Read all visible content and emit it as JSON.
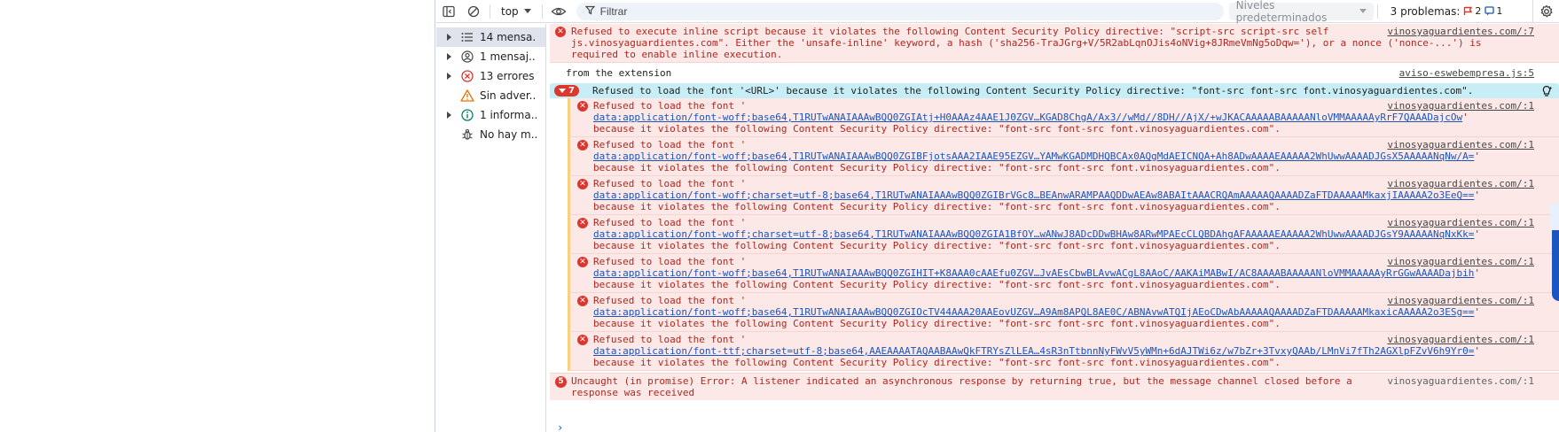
{
  "toolbar": {
    "context_label": "top",
    "filter_placeholder": "Filtrar",
    "levels_label": "Niveles predeterminados",
    "problems_label": "3 problemas:",
    "problems_errors": "2",
    "problems_info": "1"
  },
  "sidebar": {
    "items": [
      {
        "label": "14 mensa...",
        "icon": "list-icon"
      },
      {
        "label": "1 mensaj...",
        "icon": "user-icon"
      },
      {
        "label": "13 errores",
        "icon": "error-icon"
      },
      {
        "label": "Sin adver...",
        "icon": "warning-icon"
      },
      {
        "label": "1 informa...",
        "icon": "info-icon"
      },
      {
        "label": "No hay m...",
        "icon": "bug-icon"
      }
    ]
  },
  "console": {
    "csp_message": {
      "lines": [
        "Refused to execute inline script because it violates the following Content Security Policy directive: \"script-src script-src self",
        "js.vinosyaguardientes.com\". Either the 'unsafe-inline' keyword, a hash ('sha256-TraJGrg+V/5R2abLqnOJis4oNVig+8JRmeVmNg5oDqw='), or a nonce ('nonce-...') is",
        "required to enable inline execution."
      ],
      "source": "vinosyaguardientes.com/:7"
    },
    "extension_message": {
      "text": "from the extension",
      "source": "aviso-eswebempresa.js:5"
    },
    "group": {
      "count": "7",
      "text": "Refused to load the font '<URL>' because it violates the following Content Security Policy directive: \"font-src font-src font.vinosyaguardientes.com\"."
    },
    "font_errors": [
      {
        "prefix": "Refused to load the font '",
        "url": "data:application/font-woff;base64,T1RUTwANAIAAAwBQQ0ZGIAtj+H0AAAz4AAE1J0ZGV…KGAD8ChgA/Ax3//wMd//8DH//AjX/+wJKACAAAAABAAAAANloVMMAAAAAyRrF7QAAADajcOw",
        "suffix": "'",
        "tail": "because it violates the following Content Security Policy directive: \"font-src font-src font.vinosyaguardientes.com\".",
        "source": "vinosyaguardientes.com/:1"
      },
      {
        "prefix": "Refused to load the font '",
        "url": "data:application/font-woff;base64,T1RUTwANAIAAAwBQQ0ZGIBFjotsAAA2IAAE95EZGV…YAMwKGADMDHQBCAx0AQgMdAEICNQA+Ah8ADwAAAAEAAAAA2WhUwwAAAADJGsX5AAAAANqNw/A=",
        "suffix": "'",
        "tail": "because it violates the following Content Security Policy directive: \"font-src font-src font.vinosyaguardientes.com\".",
        "source": "vinosyaguardientes.com/:1"
      },
      {
        "prefix": "Refused to load the font '",
        "url": "data:application/font-woff;charset=utf-8;base64,T1RUTwANAIAAAwBQQ0ZGIBrVGc8…BEAnwARAMPAAQDDwAEAw8ABAItAAACRQAmAAAAAQAAAADZaFTDAAAAAMkaxjIAAAAA2o3EeQ==",
        "suffix": "'",
        "tail": "because it violates the following Content Security Policy directive: \"font-src font-src font.vinosyaguardientes.com\".",
        "source": "vinosyaguardientes.com/:1"
      },
      {
        "prefix": "Refused to load the font '",
        "url": "data:application/font-woff;charset=utf-8;base64,T1RUTwANAIAAAwBQQ0ZGIA1BfOY…wANwJ8ADcDDwBHAw8ARwMPAEcCLQBDAhgAFAAAAAEAAAAA2WhUwwAAAADJGsY9AAAAANqNxKk=",
        "suffix": "'",
        "tail": "because it violates the following Content Security Policy directive: \"font-src font-src font.vinosyaguardientes.com\".",
        "source": "vinosyaguardientes.com/:1"
      },
      {
        "prefix": "Refused to load the font '",
        "url": "data:application/font-woff;base64,T1RUTwANAIAAAwBQQ0ZGIHIT+K8AAA0cAAEfu0ZGV…JvAEsCbwBLAvwACgL8AAoC/AAKAiMABwI/AC8AAAABAAAAANloVMMAAAAAyRrGGwAAAADajbih",
        "suffix": "'",
        "tail": "because it violates the following Content Security Policy directive: \"font-src font-src font.vinosyaguardientes.com\".",
        "source": "vinosyaguardientes.com/:1"
      },
      {
        "prefix": "Refused to load the font '",
        "url": "data:application/font-woff;base64,T1RUTwANAIAAAwBQQ0ZGIOcTV44AAA20AAEovUZGV…A9Am8APQL8AE0C/ABNAvwATQIjAEoCDwAbAAAAAQAAAADZaFTDAAAAAMkaxicAAAAA2o3ESg==",
        "suffix": "'",
        "tail": "because it violates the following Content Security Policy directive: \"font-src font-src font.vinosyaguardientes.com\".",
        "source": "vinosyaguardientes.com/:1"
      },
      {
        "prefix": "Refused to load the font '",
        "url": "data:application/font-ttf;charset=utf-8;base64,AAEAAAATAQAABAAwQkFTRYsZlLEA…4sR3nTtbnnNyFWvV5yWMn+6dAJTWi6z/w7bZr+3TvxyQAAb/LMnVi7fTh2AGXlpFZvV6h9Yr0=",
        "suffix": "'",
        "tail": "because it violates the following Content Security Policy directive: \"font-src font-src font.vinosyaguardientes.com\".",
        "source": "vinosyaguardientes.com/:1"
      }
    ],
    "uncaught": {
      "count": "5",
      "lines": [
        "Uncaught (in promise) Error: A listener indicated an asynchronous response by returning true, but the message channel closed before a",
        "response was received"
      ],
      "source": "vinosyaguardientes.com/:1"
    },
    "prompt": "›"
  },
  "colors": {
    "error_bg": "#fce8e6",
    "error_text": "#b3261e",
    "group_bg": "#c7eef7",
    "error_icon": "#dc362e",
    "warning_border": "#f7cf7f"
  }
}
